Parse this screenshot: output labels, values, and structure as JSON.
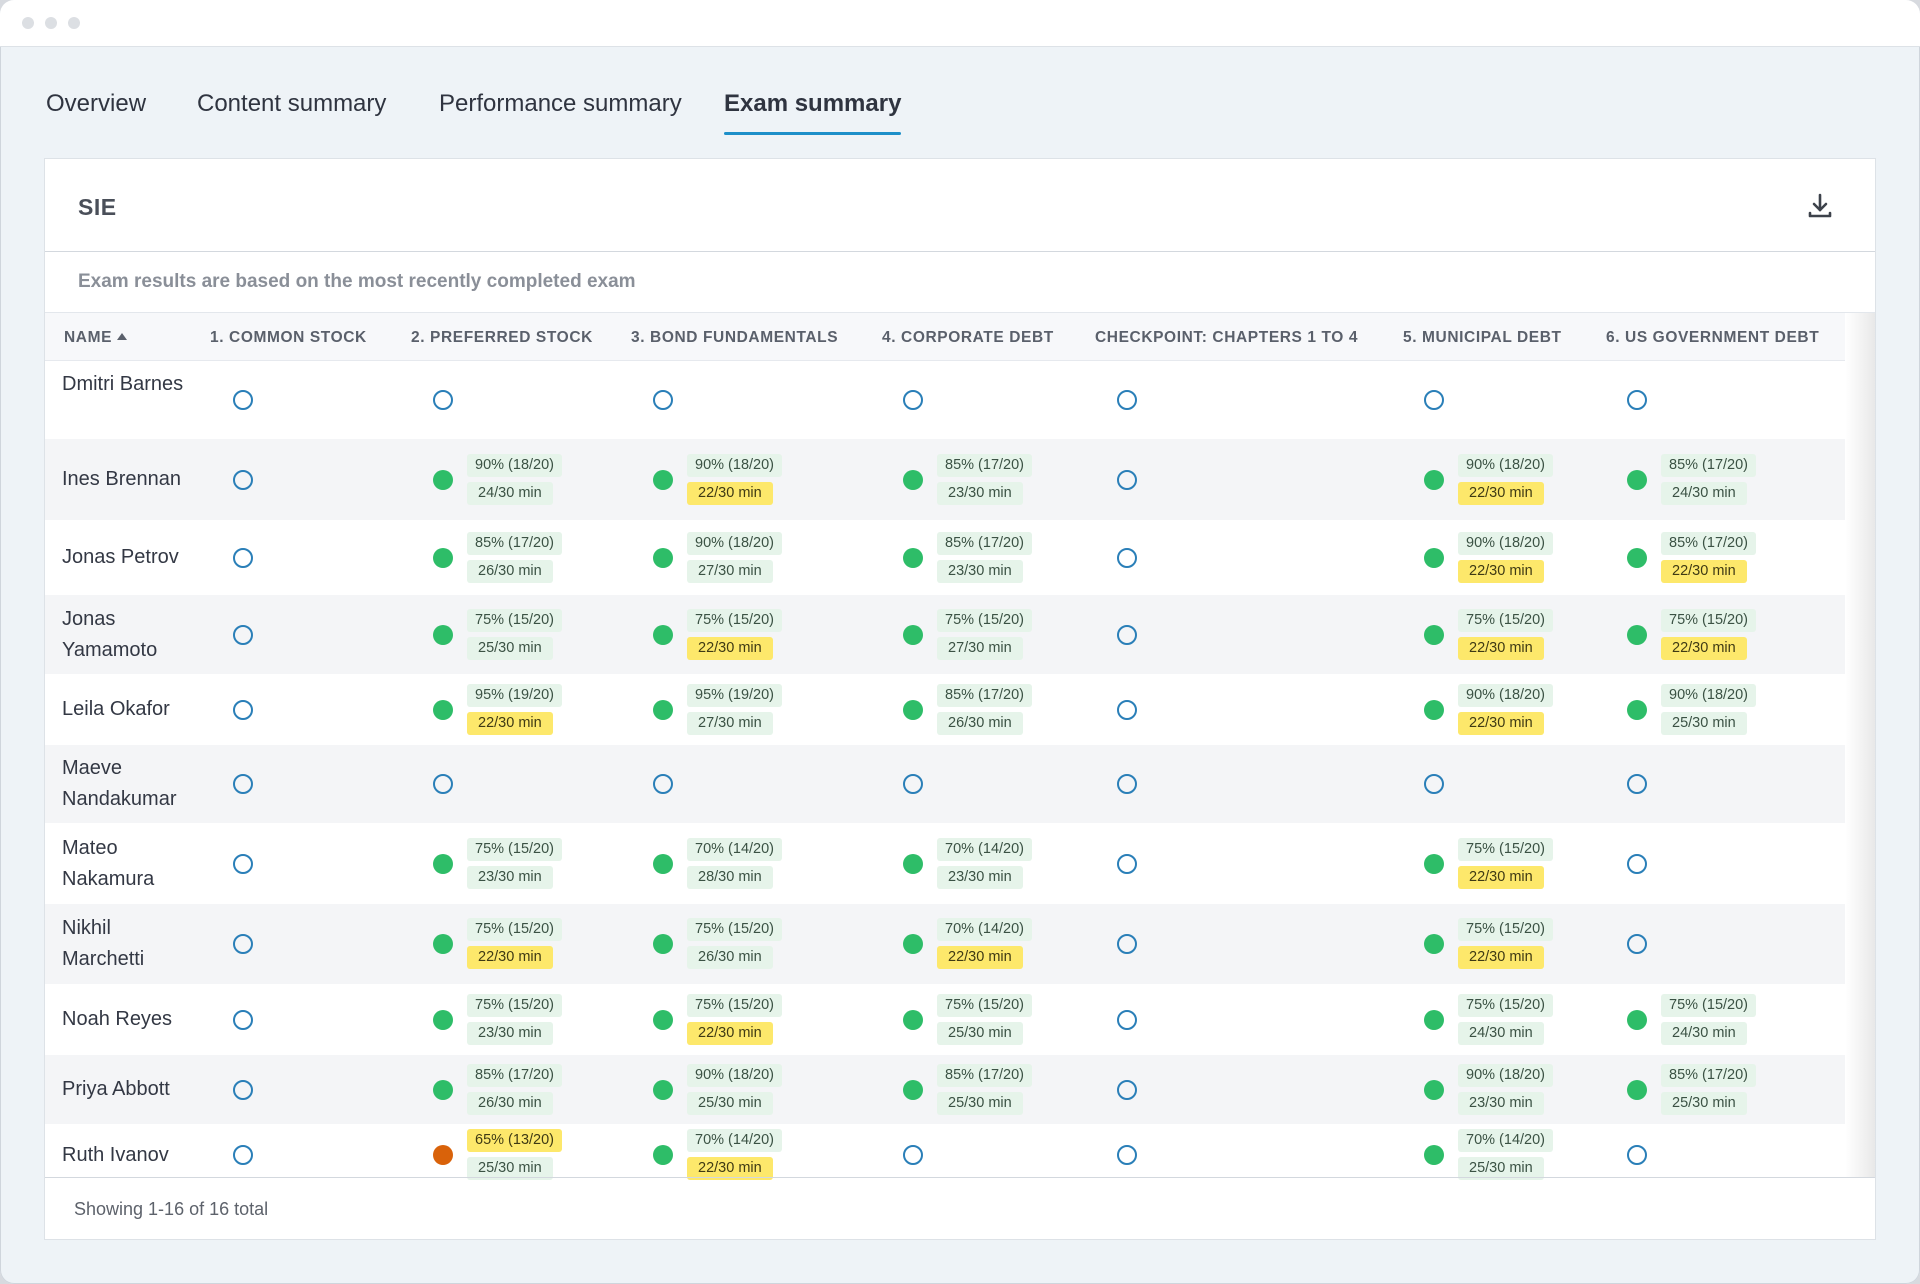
{
  "tabs": [
    {
      "label": "Overview",
      "active": false
    },
    {
      "label": "Content summary",
      "active": false
    },
    {
      "label": "Performance summary",
      "active": false
    },
    {
      "label": "Exam summary",
      "active": true
    }
  ],
  "card": {
    "title": "SIE",
    "download_icon": "download-icon",
    "note": "Exam results are based on the most recently completed exam"
  },
  "table": {
    "columns": [
      "NAME",
      "1. COMMON STOCK",
      "2. PREFERRED STOCK",
      "3. BOND FUNDAMENTALS",
      "4. CORPORATE DEBT",
      "CHECKPOINT: CHAPTERS 1 TO 4",
      "5. MUNICIPAL DEBT",
      "6. US GOVERNMENT DEBT"
    ],
    "sort": {
      "column": "NAME",
      "direction": "ascending"
    },
    "status_colors": {
      "pass": "#2ebd68",
      "fail": "#d9620a",
      "not_started": "#2a7fb8",
      "score_badge": "#e6f4ea",
      "time_highlight": "#fde86b"
    },
    "rows": [
      {
        "name": "Dmitri Barnes",
        "cells": [
          {
            "status": "empty"
          },
          {
            "status": "empty"
          },
          {
            "status": "empty"
          },
          {
            "status": "empty"
          },
          {
            "status": "empty"
          },
          {
            "status": "empty"
          },
          {
            "status": "empty"
          }
        ]
      },
      {
        "name": "Ines Brennan",
        "cells": [
          {
            "status": "empty"
          },
          {
            "status": "pass",
            "score": "90% (18/20)",
            "time": "24/30 min",
            "time_highlight": false
          },
          {
            "status": "pass",
            "score": "90% (18/20)",
            "time": "22/30 min",
            "time_highlight": true
          },
          {
            "status": "pass",
            "score": "85% (17/20)",
            "time": "23/30 min",
            "time_highlight": false
          },
          {
            "status": "empty"
          },
          {
            "status": "pass",
            "score": "90% (18/20)",
            "time": "22/30 min",
            "time_highlight": true
          },
          {
            "status": "pass",
            "score": "85% (17/20)",
            "time": "24/30 min",
            "time_highlight": false
          }
        ]
      },
      {
        "name": "Jonas Petrov",
        "cells": [
          {
            "status": "empty"
          },
          {
            "status": "pass",
            "score": "85% (17/20)",
            "time": "26/30 min",
            "time_highlight": false
          },
          {
            "status": "pass",
            "score": "90% (18/20)",
            "time": "27/30 min",
            "time_highlight": false
          },
          {
            "status": "pass",
            "score": "85% (17/20)",
            "time": "23/30 min",
            "time_highlight": false
          },
          {
            "status": "empty"
          },
          {
            "status": "pass",
            "score": "90% (18/20)",
            "time": "22/30 min",
            "time_highlight": true
          },
          {
            "status": "pass",
            "score": "85% (17/20)",
            "time": "22/30 min",
            "time_highlight": true
          }
        ]
      },
      {
        "name": "Jonas Yamamoto",
        "cells": [
          {
            "status": "empty"
          },
          {
            "status": "pass",
            "score": "75% (15/20)",
            "time": "25/30 min",
            "time_highlight": false
          },
          {
            "status": "pass",
            "score": "75% (15/20)",
            "time": "22/30 min",
            "time_highlight": true
          },
          {
            "status": "pass",
            "score": "75% (15/20)",
            "time": "27/30 min",
            "time_highlight": false
          },
          {
            "status": "empty"
          },
          {
            "status": "pass",
            "score": "75% (15/20)",
            "time": "22/30 min",
            "time_highlight": true
          },
          {
            "status": "pass",
            "score": "75% (15/20)",
            "time": "22/30 min",
            "time_highlight": true
          }
        ]
      },
      {
        "name": "Leila Okafor",
        "cells": [
          {
            "status": "empty"
          },
          {
            "status": "pass",
            "score": "95% (19/20)",
            "time": "22/30 min",
            "time_highlight": true
          },
          {
            "status": "pass",
            "score": "95% (19/20)",
            "time": "27/30 min",
            "time_highlight": false
          },
          {
            "status": "pass",
            "score": "85% (17/20)",
            "time": "26/30 min",
            "time_highlight": false
          },
          {
            "status": "empty"
          },
          {
            "status": "pass",
            "score": "90% (18/20)",
            "time": "22/30 min",
            "time_highlight": true
          },
          {
            "status": "pass",
            "score": "90% (18/20)",
            "time": "25/30 min",
            "time_highlight": false
          }
        ]
      },
      {
        "name": "Maeve Nandakumar",
        "cells": [
          {
            "status": "empty"
          },
          {
            "status": "empty"
          },
          {
            "status": "empty"
          },
          {
            "status": "empty"
          },
          {
            "status": "empty"
          },
          {
            "status": "empty"
          },
          {
            "status": "empty"
          }
        ]
      },
      {
        "name": "Mateo Nakamura",
        "cells": [
          {
            "status": "empty"
          },
          {
            "status": "pass",
            "score": "75% (15/20)",
            "time": "23/30 min",
            "time_highlight": false
          },
          {
            "status": "pass",
            "score": "70% (14/20)",
            "time": "28/30 min",
            "time_highlight": false
          },
          {
            "status": "pass",
            "score": "70% (14/20)",
            "time": "23/30 min",
            "time_highlight": false
          },
          {
            "status": "empty"
          },
          {
            "status": "pass",
            "score": "75% (15/20)",
            "time": "22/30 min",
            "time_highlight": true
          },
          {
            "status": "empty"
          }
        ]
      },
      {
        "name": "Nikhil Marchetti",
        "cells": [
          {
            "status": "empty"
          },
          {
            "status": "pass",
            "score": "75% (15/20)",
            "time": "22/30 min",
            "time_highlight": true
          },
          {
            "status": "pass",
            "score": "75% (15/20)",
            "time": "26/30 min",
            "time_highlight": false
          },
          {
            "status": "pass",
            "score": "70% (14/20)",
            "time": "22/30 min",
            "time_highlight": true
          },
          {
            "status": "empty"
          },
          {
            "status": "pass",
            "score": "75% (15/20)",
            "time": "22/30 min",
            "time_highlight": true
          },
          {
            "status": "empty"
          }
        ]
      },
      {
        "name": "Noah Reyes",
        "cells": [
          {
            "status": "empty"
          },
          {
            "status": "pass",
            "score": "75% (15/20)",
            "time": "23/30 min",
            "time_highlight": false
          },
          {
            "status": "pass",
            "score": "75% (15/20)",
            "time": "22/30 min",
            "time_highlight": true
          },
          {
            "status": "pass",
            "score": "75% (15/20)",
            "time": "25/30 min",
            "time_highlight": false
          },
          {
            "status": "empty"
          },
          {
            "status": "pass",
            "score": "75% (15/20)",
            "time": "24/30 min",
            "time_highlight": false
          },
          {
            "status": "pass",
            "score": "75% (15/20)",
            "time": "24/30 min",
            "time_highlight": false
          }
        ]
      },
      {
        "name": "Priya Abbott",
        "cells": [
          {
            "status": "empty"
          },
          {
            "status": "pass",
            "score": "85% (17/20)",
            "time": "26/30 min",
            "time_highlight": false
          },
          {
            "status": "pass",
            "score": "90% (18/20)",
            "time": "25/30 min",
            "time_highlight": false
          },
          {
            "status": "pass",
            "score": "85% (17/20)",
            "time": "25/30 min",
            "time_highlight": false
          },
          {
            "status": "empty"
          },
          {
            "status": "pass",
            "score": "90% (18/20)",
            "time": "23/30 min",
            "time_highlight": false
          },
          {
            "status": "pass",
            "score": "85% (17/20)",
            "time": "25/30 min",
            "time_highlight": false
          }
        ]
      },
      {
        "name": "Ruth Ivanov",
        "cells": [
          {
            "status": "empty"
          },
          {
            "status": "fail",
            "score": "65% (13/20)",
            "score_highlight": true,
            "time": "25/30 min",
            "time_highlight": false
          },
          {
            "status": "pass",
            "score": "70% (14/20)",
            "time": "22/30 min",
            "time_highlight": true
          },
          {
            "status": "empty"
          },
          {
            "status": "empty"
          },
          {
            "status": "pass",
            "score": "70% (14/20)",
            "time": "25/30 min",
            "time_highlight": false
          },
          {
            "status": "empty"
          }
        ]
      }
    ]
  },
  "footer": {
    "text": "Showing 1-16 of 16 total"
  }
}
